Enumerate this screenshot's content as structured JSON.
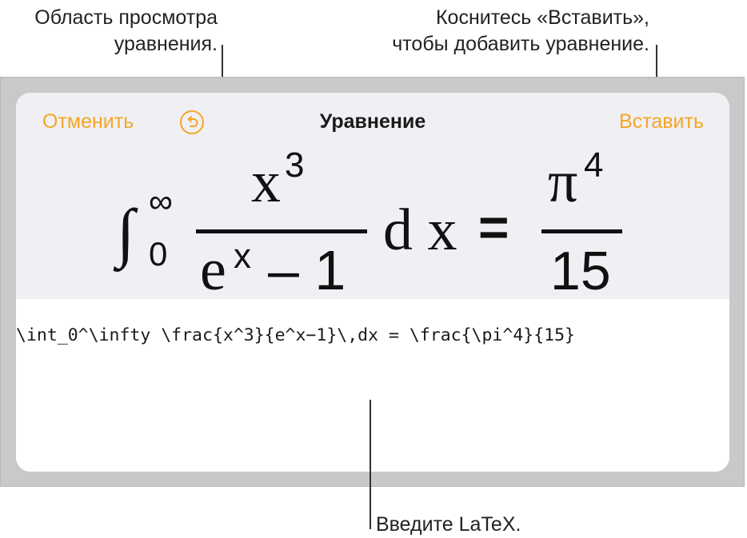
{
  "callouts": {
    "preview_line1": "Область просмотра",
    "preview_line2": "уравнения.",
    "insert_line1": "Коснитесь «Вставить»,",
    "insert_line2": "чтобы добавить уравнение.",
    "latex": "Введите LaTeX."
  },
  "toolbar": {
    "cancel_label": "Отменить",
    "title": "Уравнение",
    "insert_label": "Вставить",
    "undo_icon": "undo-icon"
  },
  "preview": {
    "integral": "∫",
    "upper_limit": "∞",
    "lower_limit": "0",
    "num_base": "x",
    "num_exp": "3",
    "den_base": "e",
    "den_exp": "x",
    "den_rest": "– 1",
    "dx": "d x",
    "equals": "=",
    "rhs_num_base": "π",
    "rhs_num_exp": "4",
    "rhs_den": "15"
  },
  "latex_input": {
    "value": "\\int_0^\\infty \\frac{x^3}{e^x−1}\\,dx = \\frac{\\pi^4}{15}"
  },
  "colors": {
    "accent": "#f5a623",
    "preview_bg": "#efeff4",
    "frame_bg": "#c9c9c9"
  }
}
